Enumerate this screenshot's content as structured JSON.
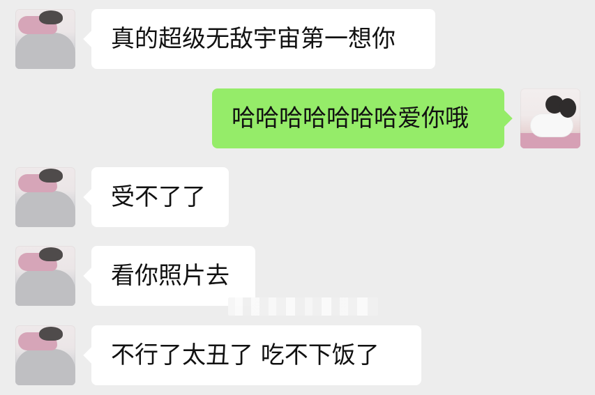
{
  "messages": [
    {
      "side": "them",
      "text": "真的超级无敌宇宙第一想你"
    },
    {
      "side": "me",
      "text": "哈哈哈哈哈哈哈爱你哦"
    },
    {
      "side": "them",
      "text": "受不了了"
    },
    {
      "side": "them",
      "text": "看你照片去"
    },
    {
      "side": "them",
      "text": "不行了太丑了  吃不下饭了"
    }
  ],
  "colors": {
    "background": "#ededed",
    "incoming_bubble": "#ffffff",
    "outgoing_bubble": "#95ec69",
    "text": "#111111"
  },
  "icons": {
    "incoming_avatar": "avatar-photo",
    "outgoing_avatar": "avatar-photo"
  }
}
